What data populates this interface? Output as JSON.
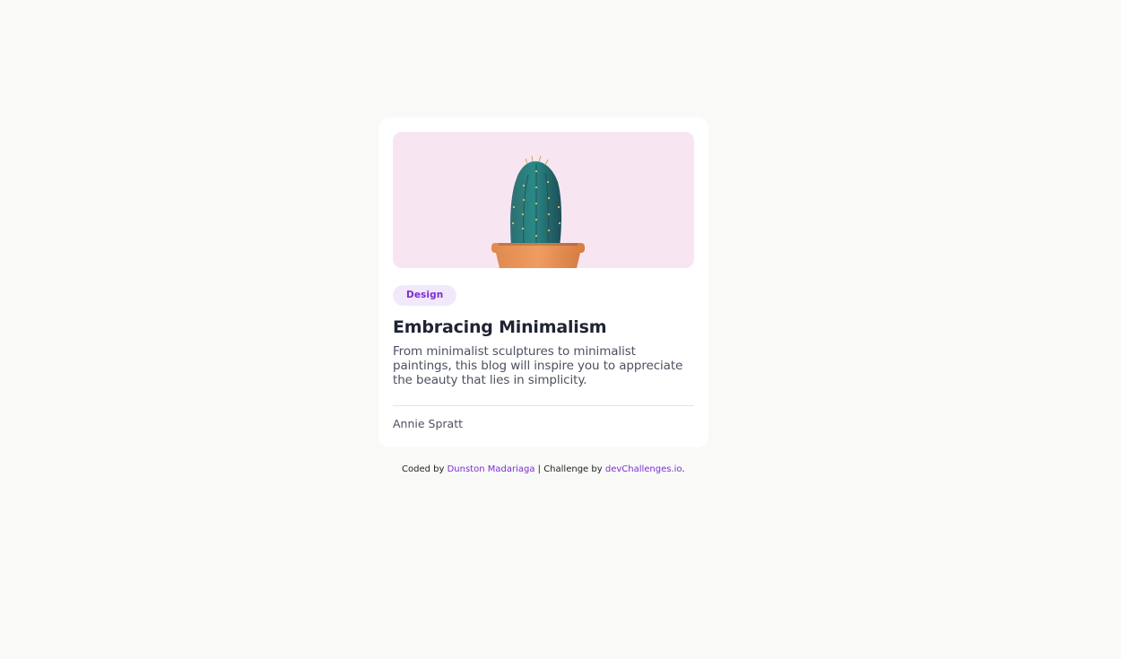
{
  "card": {
    "image_alt": "cactus",
    "tag": "Design",
    "title": "Embracing Minimalism",
    "description": "From minimalist sculptures to minimalist paintings, this blog will inspire you to appreciate the beauty that lies in simplicity.",
    "author": "Annie Spratt"
  },
  "footer": {
    "prefix": "Coded by",
    "author_link": "Dunston Madariaga",
    "separator": "| Challenge by",
    "challenge_link": "devChallenges.io",
    "suffix": "."
  },
  "colors": {
    "background": "#f9f9f8",
    "card": "#ffffff",
    "accent": "#7b2fd0",
    "tag_bg": "#f1e9fb",
    "hero_bg": "#f7e6f1"
  }
}
